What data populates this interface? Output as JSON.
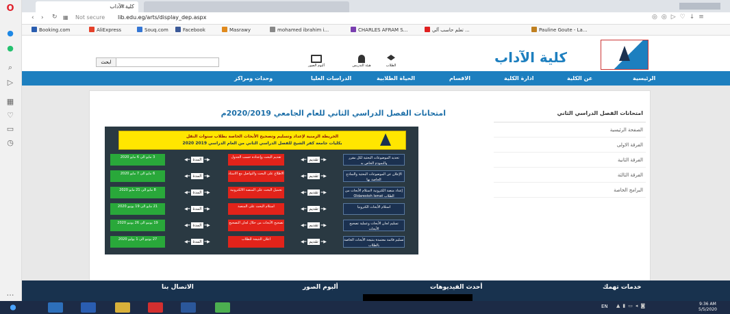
{
  "browser": {
    "tabs": [
      {
        "title": "كلية الآداب"
      },
      {
        "title": ""
      }
    ],
    "address": {
      "security": "Not secure",
      "url": "lib.edu.eg/arts/display_dep.aspx"
    },
    "bookmarks": [
      {
        "label": "Booking.com",
        "color": "#2a5db0"
      },
      {
        "label": "AliExpress",
        "color": "#e5422b"
      },
      {
        "label": "Souq.com",
        "color": "#3476d4"
      },
      {
        "label": "Facebook",
        "color": "#3b5998"
      },
      {
        "label": "Masrawy",
        "color": "#e08a1e"
      },
      {
        "label": "mohamed ibrahim i...",
        "color": "#888888"
      },
      {
        "label": "CHARLES AFRAM S...",
        "color": "#7a3fb0"
      },
      {
        "label": "تعلم حاسب آلي ...",
        "color": "#e02020"
      },
      {
        "label": "Pauline Goute - La...",
        "color": "#c08020"
      }
    ]
  },
  "site": {
    "logo_text": "كلية الآداب",
    "search_button": "ابحث",
    "search_placeholder": "",
    "quick_links": [
      {
        "label": "ألبوم الصور",
        "icon": "photo-icon"
      },
      {
        "label": "هيئة التدريس",
        "icon": "staff-icon"
      },
      {
        "label": "الطلاب",
        "icon": "graduate-icon"
      }
    ],
    "nav": [
      "الرئيسية",
      "عن الكلية",
      "ادارة الكلية",
      "الاقسام",
      "الحياة الطلابية",
      "الدراسات العليا",
      "وحدات ومراكز"
    ]
  },
  "main": {
    "title": "امتحانات الفصل الدراسي الثاني للعام الجامعي 2020/2019م",
    "sidebar_title": "امتحانات الفصل الدراسي الثاني",
    "sidebar_items": [
      "الصفحة الرئيسية",
      "الفرقة الاولى",
      "الفرقة الثانية",
      "الفرقة الثالثة",
      "البرامج الخاصة"
    ],
    "poster": {
      "heading": "الخريطة الزمنية لإعداد وتسليم وتصحيح الأبحاث الخاصة بطلاب سنوات النقل",
      "subheading": "بكليات جامعة كفر الشيخ للفصل الدراسي الثاني من العام الدراسي 2019 2020",
      "rows": [
        {
          "blue": "تحديد الموضوعات البحثية لكل مقرر والنموذج الخاص به",
          "red": "تقديم البحث وإعداده حسب الجدول",
          "green": "3 مايو الى 6 مايو 2020"
        },
        {
          "blue": "الإعلان عن الموضوعات البحثية والنماذج الخاصة بها",
          "red": "الاطلاع على البحث والتواصل مع الاستاذ",
          "green": "6 مايو الى 7 مايو 2020"
        },
        {
          "blue": "إعداد منصة الكترونية لاستلام الأبحاث من الطلاب Oldarestoh Ismat",
          "red": "تحميل البحث على المنصة الالكترونية",
          "green": "8 مايو الى 21 مايو 2020"
        },
        {
          "blue": "استلام الأبحاث الكترونيا",
          "red": "استلام البحث على المنصة",
          "green": "21 مايو الى 19 يونيو 2020"
        },
        {
          "blue": "تسليم لجان الأبحاث وعملية تصحيح الأبحاث",
          "red": "تصحيح الأبحاث من خلال لجان التصحيح",
          "green": "19 يونيو الى 26 يونيو 2020"
        },
        {
          "blue": "تسليم قائمة معتمدة بنتيجة الأبحاث الخاصة بالطلاب",
          "red": "اعلان النتيجة للطلاب",
          "green": "27 يونيو الى 1 يوليو 2020"
        }
      ],
      "arrow_labels": [
        "المدة",
        "تقديم"
      ]
    }
  },
  "footer": {
    "headings": [
      "خدمات تهمك",
      "أحدث الفيديوهات",
      "ألبوم الصور",
      "الاتصال بنا"
    ]
  },
  "taskbar": {
    "lang": "EN",
    "time": "9:36 AM",
    "date": "5/5/2020"
  },
  "colors": {
    "nav_blue": "#1d7fbf",
    "footer_navy": "#18324e",
    "poster_bg": "#2a3942",
    "accent_red": "#e2231a",
    "accent_green": "#29a83a",
    "title_blue": "#1d6fa8"
  }
}
